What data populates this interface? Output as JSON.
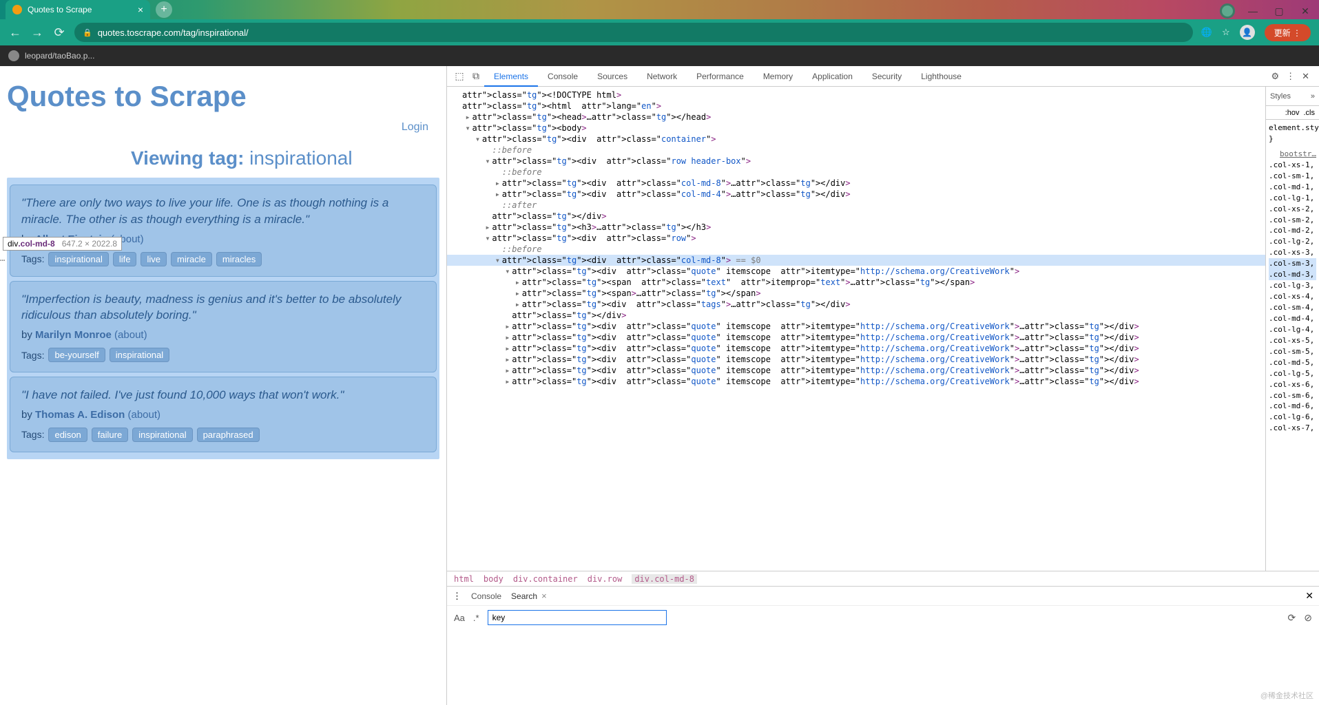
{
  "browser": {
    "tab_title": "Quotes to Scrape",
    "url": "quotes.toscrape.com/tag/inspirational/",
    "bookmark": "leopard/taoBao.p...",
    "update": "更新"
  },
  "page": {
    "site_title": "Quotes to Scrape",
    "login": "Login",
    "tag_heading": "Viewing tag: inspirational",
    "inspect_tip_sel": "div.col-md-8",
    "inspect_tip_dim": "647.2 × 2022.8",
    "quotes": [
      {
        "text": "\"There are only two ways to live your life. One is as though nothing is a miracle. The other is as though everything is a miracle.\"",
        "by": "by",
        "author": "Albert Einstein",
        "about": "(about)",
        "tags_label": "Tags:",
        "tags": [
          "inspirational",
          "life",
          "live",
          "miracle",
          "miracles"
        ]
      },
      {
        "text": "\"Imperfection is beauty, madness is genius and it's better to be absolutely ridiculous than absolutely boring.\"",
        "by": "by",
        "author": "Marilyn Monroe",
        "about": "(about)",
        "tags_label": "Tags:",
        "tags": [
          "be-yourself",
          "inspirational"
        ]
      },
      {
        "text": "\"I have not failed. I've just found 10,000 ways that won't work.\"",
        "by": "by",
        "author": "Thomas A. Edison",
        "about": "(about)",
        "tags_label": "Tags:",
        "tags": [
          "edison",
          "failure",
          "inspirational",
          "paraphrased"
        ]
      }
    ]
  },
  "devtools": {
    "tabs": [
      "Elements",
      "Console",
      "Sources",
      "Network",
      "Performance",
      "Memory",
      "Application",
      "Security",
      "Lighthouse"
    ],
    "active_tab": "Elements",
    "breadcrumb": [
      "html",
      "body",
      "div.container",
      "div.row",
      "div.col-md-8"
    ],
    "dom_lines": [
      {
        "i": 0,
        "c": "",
        "t": "<!DOCTYPE html>"
      },
      {
        "i": 0,
        "c": "",
        "t": "<html lang=\"en\">"
      },
      {
        "i": 1,
        "c": "▸",
        "t": "<head>…</head>"
      },
      {
        "i": 1,
        "c": "▾",
        "t": "<body>"
      },
      {
        "i": 2,
        "c": "▾",
        "t": "<div class=\"container\">"
      },
      {
        "i": 3,
        "c": "",
        "t": "::before",
        "pseudo": true
      },
      {
        "i": 3,
        "c": "▾",
        "t": "<div class=\"row header-box\">"
      },
      {
        "i": 4,
        "c": "",
        "t": "::before",
        "pseudo": true
      },
      {
        "i": 4,
        "c": "▸",
        "t": "<div class=\"col-md-8\">…</div>"
      },
      {
        "i": 4,
        "c": "▸",
        "t": "<div class=\"col-md-4\">…</div>"
      },
      {
        "i": 4,
        "c": "",
        "t": "::after",
        "pseudo": true
      },
      {
        "i": 3,
        "c": "",
        "t": "</div>"
      },
      {
        "i": 3,
        "c": "▸",
        "t": "<h3>…</h3>"
      },
      {
        "i": 3,
        "c": "▾",
        "t": "<div class=\"row\">"
      },
      {
        "i": 4,
        "c": "",
        "t": "::before",
        "pseudo": true
      },
      {
        "i": 4,
        "c": "▾",
        "t": "<div class=\"col-md-8\"> == $0",
        "sel": true,
        "dots": true
      },
      {
        "i": 5,
        "c": "▾",
        "t": "<div class=\"quote\" itemscope itemtype=\"http://schema.org/CreativeWork\">"
      },
      {
        "i": 6,
        "c": "▸",
        "t": "<span class=\"text\" itemprop=\"text\">…</span>"
      },
      {
        "i": 6,
        "c": "▸",
        "t": "<span>…</span>"
      },
      {
        "i": 6,
        "c": "▸",
        "t": "<div class=\"tags\">…</div>"
      },
      {
        "i": 5,
        "c": "",
        "t": "</div>"
      },
      {
        "i": 5,
        "c": "▸",
        "t": "<div class=\"quote\" itemscope itemtype=\"http://schema.org/CreativeWork\">…</div>"
      },
      {
        "i": 5,
        "c": "▸",
        "t": "<div class=\"quote\" itemscope itemtype=\"http://schema.org/CreativeWork\">…</div>"
      },
      {
        "i": 5,
        "c": "▸",
        "t": "<div class=\"quote\" itemscope itemtype=\"http://schema.org/CreativeWork\">…</div>"
      },
      {
        "i": 5,
        "c": "▸",
        "t": "<div class=\"quote\" itemscope itemtype=\"http://schema.org/CreativeWork\">…</div>"
      },
      {
        "i": 5,
        "c": "▸",
        "t": "<div class=\"quote\" itemscope itemtype=\"http://schema.org/CreativeWork\">…</div>"
      },
      {
        "i": 5,
        "c": "▸",
        "t": "<div class=\"quote\" itemscope itemtype=\"http://schema.org/CreativeWork\">…</div>"
      }
    ],
    "styles": {
      "title": "Styles",
      "hov": ":hov",
      "cls": ".cls",
      "element_style": "element.style {",
      "close": "}",
      "link": "bootstr…",
      "rules": [
        ".col-xs-1,",
        ".col-sm-1,",
        ".col-md-1,",
        ".col-lg-1,",
        ".col-xs-2,",
        ".col-sm-2,",
        ".col-md-2,",
        ".col-lg-2,",
        ".col-xs-3,",
        ".col-sm-3,",
        ".col-md-3,",
        ".col-lg-3,",
        ".col-xs-4,",
        ".col-sm-4,",
        ".col-md-4,",
        ".col-lg-4,",
        ".col-xs-5,",
        ".col-sm-5,",
        ".col-md-5,",
        ".col-lg-5,",
        ".col-xs-6,",
        ".col-sm-6,",
        ".col-md-6,",
        ".col-lg-6,",
        ".col-xs-7,"
      ]
    },
    "drawer": {
      "tabs": [
        "Console",
        "Search"
      ],
      "active": "Search",
      "search_value": "key",
      "aa": "Aa",
      "rx": ".*"
    }
  },
  "watermark": "@稀金技术社区"
}
